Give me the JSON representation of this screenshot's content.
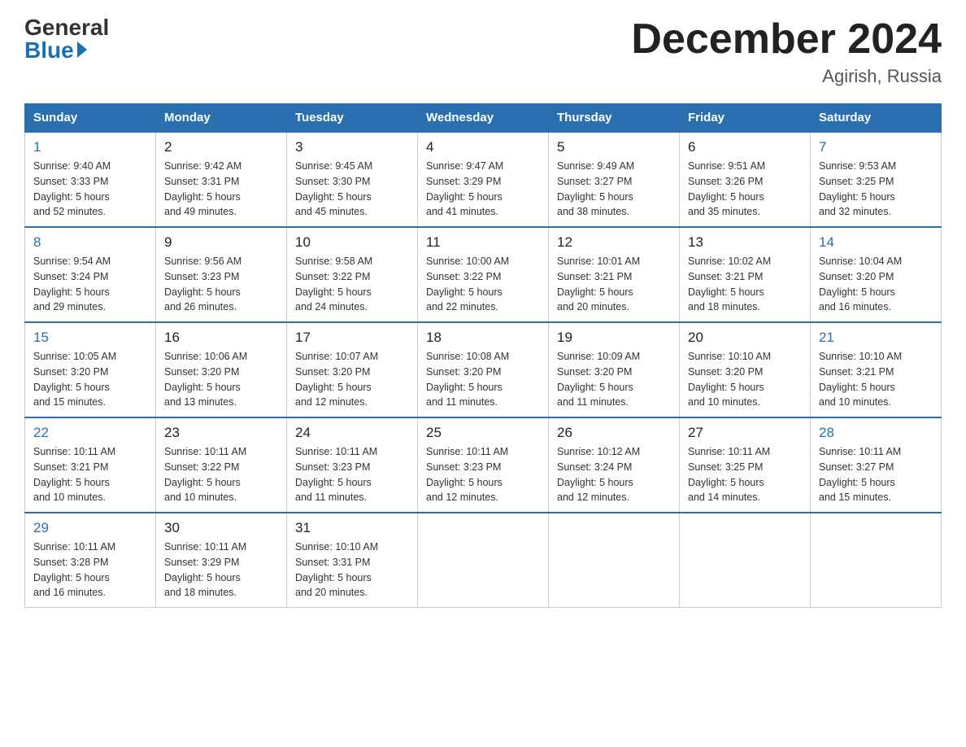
{
  "header": {
    "logo_general": "General",
    "logo_blue": "Blue",
    "month_title": "December 2024",
    "location": "Agirish, Russia"
  },
  "days_of_week": [
    "Sunday",
    "Monday",
    "Tuesday",
    "Wednesday",
    "Thursday",
    "Friday",
    "Saturday"
  ],
  "weeks": [
    [
      {
        "day": "1",
        "sunrise": "9:40 AM",
        "sunset": "3:33 PM",
        "daylight": "5 hours and 52 minutes."
      },
      {
        "day": "2",
        "sunrise": "9:42 AM",
        "sunset": "3:31 PM",
        "daylight": "5 hours and 49 minutes."
      },
      {
        "day": "3",
        "sunrise": "9:45 AM",
        "sunset": "3:30 PM",
        "daylight": "5 hours and 45 minutes."
      },
      {
        "day": "4",
        "sunrise": "9:47 AM",
        "sunset": "3:29 PM",
        "daylight": "5 hours and 41 minutes."
      },
      {
        "day": "5",
        "sunrise": "9:49 AM",
        "sunset": "3:27 PM",
        "daylight": "5 hours and 38 minutes."
      },
      {
        "day": "6",
        "sunrise": "9:51 AM",
        "sunset": "3:26 PM",
        "daylight": "5 hours and 35 minutes."
      },
      {
        "day": "7",
        "sunrise": "9:53 AM",
        "sunset": "3:25 PM",
        "daylight": "5 hours and 32 minutes."
      }
    ],
    [
      {
        "day": "8",
        "sunrise": "9:54 AM",
        "sunset": "3:24 PM",
        "daylight": "5 hours and 29 minutes."
      },
      {
        "day": "9",
        "sunrise": "9:56 AM",
        "sunset": "3:23 PM",
        "daylight": "5 hours and 26 minutes."
      },
      {
        "day": "10",
        "sunrise": "9:58 AM",
        "sunset": "3:22 PM",
        "daylight": "5 hours and 24 minutes."
      },
      {
        "day": "11",
        "sunrise": "10:00 AM",
        "sunset": "3:22 PM",
        "daylight": "5 hours and 22 minutes."
      },
      {
        "day": "12",
        "sunrise": "10:01 AM",
        "sunset": "3:21 PM",
        "daylight": "5 hours and 20 minutes."
      },
      {
        "day": "13",
        "sunrise": "10:02 AM",
        "sunset": "3:21 PM",
        "daylight": "5 hours and 18 minutes."
      },
      {
        "day": "14",
        "sunrise": "10:04 AM",
        "sunset": "3:20 PM",
        "daylight": "5 hours and 16 minutes."
      }
    ],
    [
      {
        "day": "15",
        "sunrise": "10:05 AM",
        "sunset": "3:20 PM",
        "daylight": "5 hours and 15 minutes."
      },
      {
        "day": "16",
        "sunrise": "10:06 AM",
        "sunset": "3:20 PM",
        "daylight": "5 hours and 13 minutes."
      },
      {
        "day": "17",
        "sunrise": "10:07 AM",
        "sunset": "3:20 PM",
        "daylight": "5 hours and 12 minutes."
      },
      {
        "day": "18",
        "sunrise": "10:08 AM",
        "sunset": "3:20 PM",
        "daylight": "5 hours and 11 minutes."
      },
      {
        "day": "19",
        "sunrise": "10:09 AM",
        "sunset": "3:20 PM",
        "daylight": "5 hours and 11 minutes."
      },
      {
        "day": "20",
        "sunrise": "10:10 AM",
        "sunset": "3:20 PM",
        "daylight": "5 hours and 10 minutes."
      },
      {
        "day": "21",
        "sunrise": "10:10 AM",
        "sunset": "3:21 PM",
        "daylight": "5 hours and 10 minutes."
      }
    ],
    [
      {
        "day": "22",
        "sunrise": "10:11 AM",
        "sunset": "3:21 PM",
        "daylight": "5 hours and 10 minutes."
      },
      {
        "day": "23",
        "sunrise": "10:11 AM",
        "sunset": "3:22 PM",
        "daylight": "5 hours and 10 minutes."
      },
      {
        "day": "24",
        "sunrise": "10:11 AM",
        "sunset": "3:23 PM",
        "daylight": "5 hours and 11 minutes."
      },
      {
        "day": "25",
        "sunrise": "10:11 AM",
        "sunset": "3:23 PM",
        "daylight": "5 hours and 12 minutes."
      },
      {
        "day": "26",
        "sunrise": "10:12 AM",
        "sunset": "3:24 PM",
        "daylight": "5 hours and 12 minutes."
      },
      {
        "day": "27",
        "sunrise": "10:11 AM",
        "sunset": "3:25 PM",
        "daylight": "5 hours and 14 minutes."
      },
      {
        "day": "28",
        "sunrise": "10:11 AM",
        "sunset": "3:27 PM",
        "daylight": "5 hours and 15 minutes."
      }
    ],
    [
      {
        "day": "29",
        "sunrise": "10:11 AM",
        "sunset": "3:28 PM",
        "daylight": "5 hours and 16 minutes."
      },
      {
        "day": "30",
        "sunrise": "10:11 AM",
        "sunset": "3:29 PM",
        "daylight": "5 hours and 18 minutes."
      },
      {
        "day": "31",
        "sunrise": "10:10 AM",
        "sunset": "3:31 PM",
        "daylight": "5 hours and 20 minutes."
      },
      null,
      null,
      null,
      null
    ]
  ],
  "labels": {
    "sunrise": "Sunrise:",
    "sunset": "Sunset:",
    "daylight": "Daylight:"
  }
}
